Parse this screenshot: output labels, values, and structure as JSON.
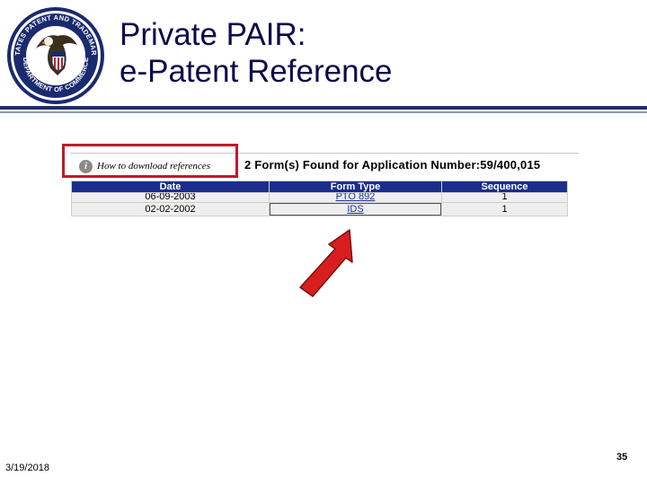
{
  "slide": {
    "title_line1": "Private PAIR:",
    "title_line2": "e-Patent Reference",
    "date": "3/19/2018",
    "page_number": "35"
  },
  "seal": {
    "text": "UNITED STATES PATENT AND TRADEMARK OFFICE · DEPARTMENT OF COMMERCE"
  },
  "screenshot": {
    "help_link": "How to download references",
    "info_icon": "i",
    "found_text": "2 Form(s) Found for Application Number:59/400,015",
    "columns": [
      "Date",
      "Form Type",
      "Sequence"
    ],
    "rows": [
      {
        "date": "06-09-2003",
        "form_type": "PTO 892",
        "sequence": "1"
      },
      {
        "date": "02-02-2002",
        "form_type": "IDS",
        "sequence": "1"
      }
    ]
  },
  "colors": {
    "title": "#0b0b4a",
    "header_blue": "#1c2e8c",
    "highlight_red": "#c4172c"
  }
}
